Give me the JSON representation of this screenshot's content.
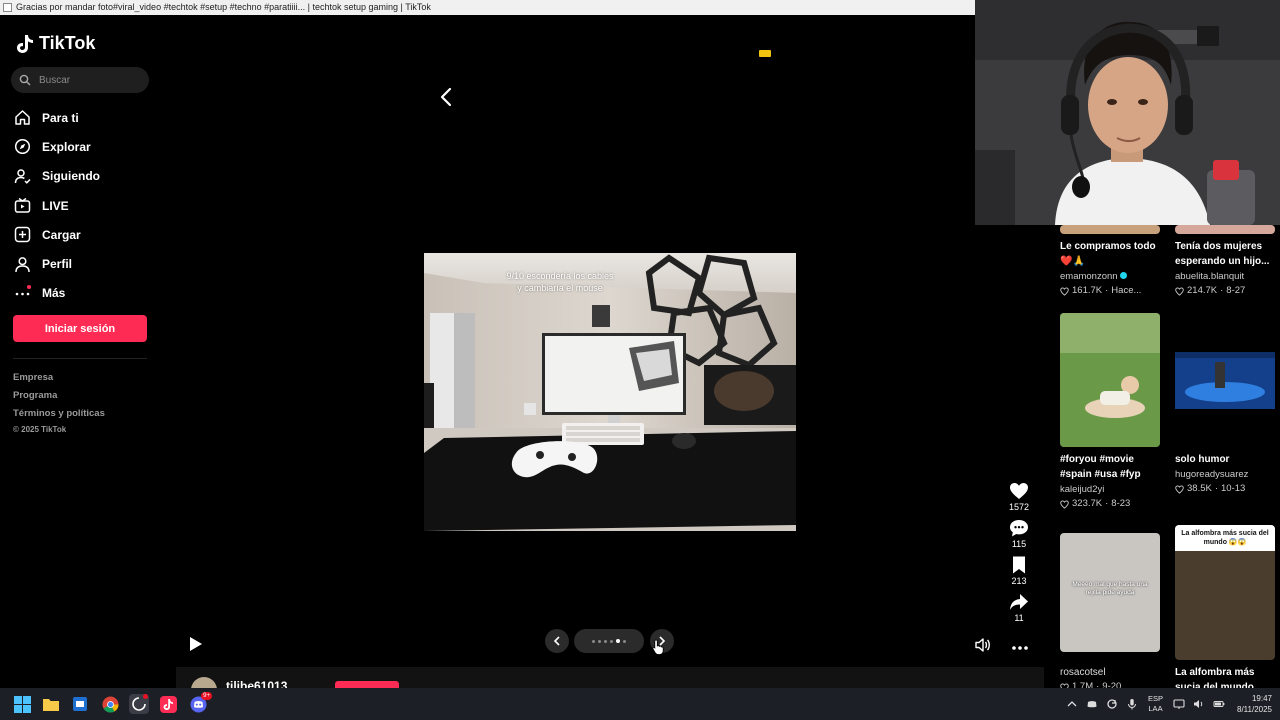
{
  "browser": {
    "window_title": "Gracias por mandar foto#viral_video #techtok #setup #techno #paratiiii... | techtok setup gaming | TikTok"
  },
  "sidebar": {
    "logo_text": "TikTok",
    "search_placeholder": "Buscar",
    "nav": [
      {
        "label": "Para ti",
        "icon": "home-icon"
      },
      {
        "label": "Explorar",
        "icon": "compass-icon"
      },
      {
        "label": "Siguiendo",
        "icon": "user-follow-icon"
      },
      {
        "label": "LIVE",
        "icon": "live-tv-icon"
      },
      {
        "label": "Cargar",
        "icon": "upload-plus-icon"
      },
      {
        "label": "Perfil",
        "icon": "profile-icon"
      },
      {
        "label": "Más",
        "icon": "more-dots-icon"
      }
    ],
    "login_button": "Iniciar sesión",
    "footer": {
      "empresa": "Empresa",
      "programa": "Programa",
      "terminos": "Términos y políticas",
      "copyright": "© 2025 TikTok"
    }
  },
  "post": {
    "caption_overlay": "9/10 escondería los cables y cambiaría el mouse",
    "author_name": "tilibe61013",
    "carousel_total": 6,
    "carousel_active": 5,
    "engagement": {
      "likes": "1572",
      "comments": "115",
      "saves": "213",
      "shares": "11"
    }
  },
  "related": [
    {
      "title": "Le compramos todo ❤️🙏",
      "author": "emamonzonn",
      "verified": true,
      "views": "161.7K",
      "date": "Hace..."
    },
    {
      "title": "Tenía dos mujeres esperando un hijo...",
      "author": "abuelita.blanquit",
      "views": "214.7K",
      "date": "8-27"
    },
    {
      "title": "#foryou #movie #spain #usa #fyp",
      "author": "kaleijud2yi",
      "views": "323.7K",
      "date": "8-23"
    },
    {
      "title": "solo humor",
      "author": "hugoreadysuarez",
      "views": "38.5K",
      "date": "10-13"
    },
    {
      "title": "",
      "author": "rosacotsel",
      "views": "1.7M",
      "date": "9-20",
      "thumb_text": "Meeeo mal que hasta una rejilla pide ayuda"
    },
    {
      "title": "La alfombra más sucia del mundo es...",
      "author": "",
      "views": "",
      "date": "",
      "thumb_text": "La alfombra más sucia del mundo 😱😱"
    }
  ],
  "taskbar": {
    "lang_top": "ESP",
    "lang_bottom": "LAA",
    "time": "19:47",
    "date": "8/11/2025",
    "discord_badge": "9+"
  },
  "colors": {
    "accent": "#fe2c55",
    "background": "#000000"
  }
}
